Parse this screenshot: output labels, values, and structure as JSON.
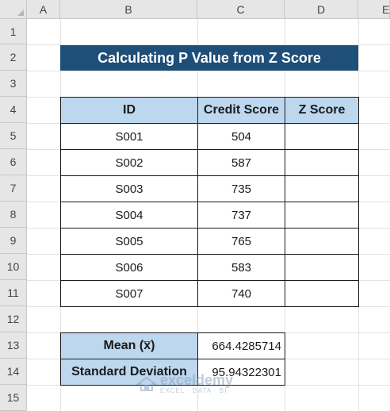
{
  "columns": [
    "A",
    "B",
    "C",
    "D",
    "E"
  ],
  "rows": [
    "1",
    "2",
    "3",
    "4",
    "5",
    "6",
    "7",
    "8",
    "9",
    "10",
    "11",
    "12",
    "13",
    "14",
    "15"
  ],
  "title": "Calculating P Value from Z Score",
  "table": {
    "headers": [
      "ID",
      "Credit Score",
      "Z Score"
    ],
    "rows": [
      {
        "id": "S001",
        "score": "504",
        "z": ""
      },
      {
        "id": "S002",
        "score": "587",
        "z": ""
      },
      {
        "id": "S003",
        "score": "735",
        "z": ""
      },
      {
        "id": "S004",
        "score": "737",
        "z": ""
      },
      {
        "id": "S005",
        "score": "765",
        "z": ""
      },
      {
        "id": "S006",
        "score": "583",
        "z": ""
      },
      {
        "id": "S007",
        "score": "740",
        "z": ""
      }
    ]
  },
  "stats": {
    "mean_label": "Mean (x̅)",
    "mean_value": "664.4285714",
    "sd_label": "Standard Deviation",
    "sd_value": "95.94322301"
  },
  "watermark": {
    "name": "exceldemy",
    "tagline": "EXCEL · DATA · BI"
  },
  "colors": {
    "title_bg": "#1f4e78",
    "header_fill": "#bdd7ee",
    "header_grey": "#e6e6e6"
  }
}
